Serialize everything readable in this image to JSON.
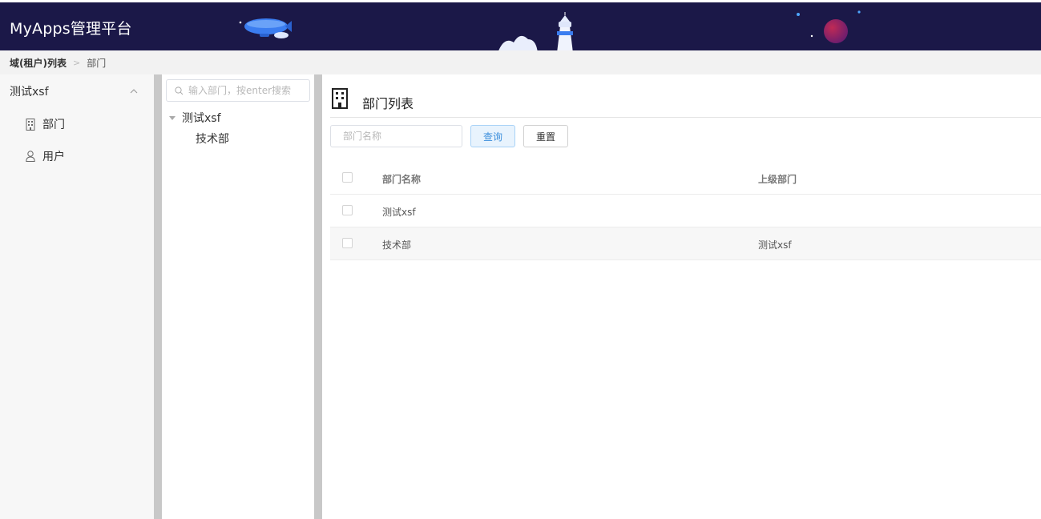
{
  "header": {
    "app_title": "MyApps管理平台",
    "background_color": "#1b1848"
  },
  "breadcrumb": {
    "root": "域(租户)列表",
    "separator": ">",
    "current": "部门"
  },
  "sidebar": {
    "group_label": "测试xsf",
    "group_icon": "chevron-up-icon",
    "items": [
      {
        "label": "部门",
        "icon": "building-icon"
      },
      {
        "label": "用户",
        "icon": "user-icon"
      }
    ]
  },
  "tree": {
    "search_placeholder": "输入部门，按enter搜索",
    "root_label": "测试xsf",
    "children": [
      {
        "label": "技术部"
      }
    ]
  },
  "main": {
    "title": "部门列表",
    "title_icon": "building-icon",
    "filter_placeholder": "部门名称",
    "query_label": "查询",
    "reset_label": "重置",
    "columns": [
      "部门名称",
      "上级部门"
    ],
    "rows": [
      {
        "name": "测试xsf",
        "parent": ""
      },
      {
        "name": "技术部",
        "parent": "测试xsf"
      }
    ]
  }
}
